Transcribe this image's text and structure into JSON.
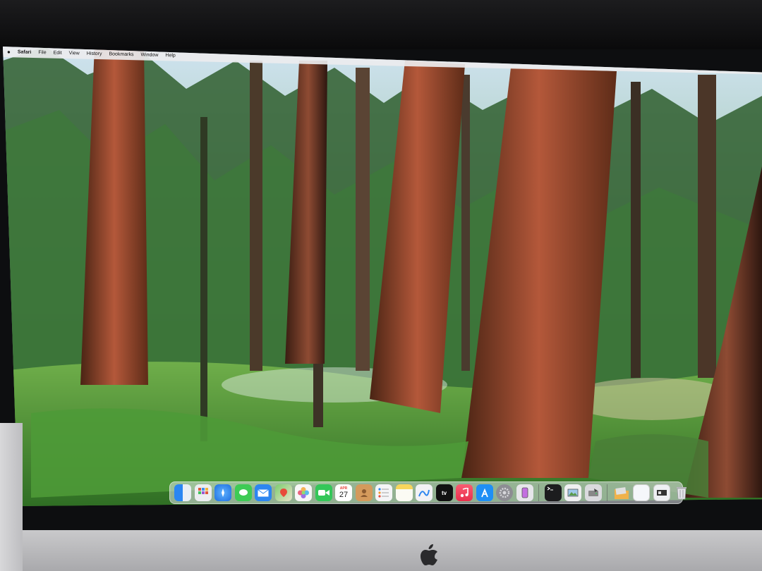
{
  "menubar": {
    "apple": "",
    "app_name": "Safari",
    "items": [
      "File",
      "Edit",
      "View",
      "History",
      "Bookmarks",
      "Window",
      "Help"
    ]
  },
  "dock": {
    "calendar_month": "APR",
    "calendar_day": "27",
    "tv_label": "tv",
    "apps": [
      {
        "icon": "finder-icon",
        "color": "#3a8ef0"
      },
      {
        "icon": "launchpad-icon",
        "color": "#e8e8ea"
      },
      {
        "icon": "safari-icon",
        "color": "#2f7ff0"
      },
      {
        "icon": "messages-icon",
        "color": "#3ecb55"
      },
      {
        "icon": "mail-icon",
        "color": "#2d86f0"
      },
      {
        "icon": "maps-icon",
        "color": "#6cc36b"
      },
      {
        "icon": "photos-icon",
        "color": "#f4f4f4"
      },
      {
        "icon": "facetime-icon",
        "color": "#34c759"
      },
      {
        "icon": "calendar-icon",
        "color": "#ffffff"
      },
      {
        "icon": "contacts-icon",
        "color": "#d49a5c"
      },
      {
        "icon": "reminders-icon",
        "color": "#f5f5f7"
      },
      {
        "icon": "notes-icon",
        "color": "#f7d55c"
      },
      {
        "icon": "freeform-icon",
        "color": "#f2f2f5"
      },
      {
        "icon": "tv-icon",
        "color": "#111111"
      },
      {
        "icon": "music-icon",
        "color": "#f2405a"
      },
      {
        "icon": "app-store-icon",
        "color": "#1f8ff5"
      },
      {
        "icon": "system-settings-icon",
        "color": "#8d8d93"
      },
      {
        "icon": "iphone-mirroring-icon",
        "color": "#e6e6ea"
      },
      {
        "icon": "terminal-icon",
        "color": "#1c1c1e"
      },
      {
        "icon": "preview-icon",
        "color": "#f0f0f2"
      },
      {
        "icon": "disk-utility-icon",
        "color": "#dadade"
      },
      {
        "icon": "downloads-folder-icon",
        "color": "#f0b24a"
      },
      {
        "icon": "documents-stack-icon",
        "color": "#f5f7fa"
      },
      {
        "icon": "screenshot-stack-icon",
        "color": "#eef0f3"
      },
      {
        "icon": "trash-icon",
        "color": "#e9eaed"
      }
    ]
  }
}
